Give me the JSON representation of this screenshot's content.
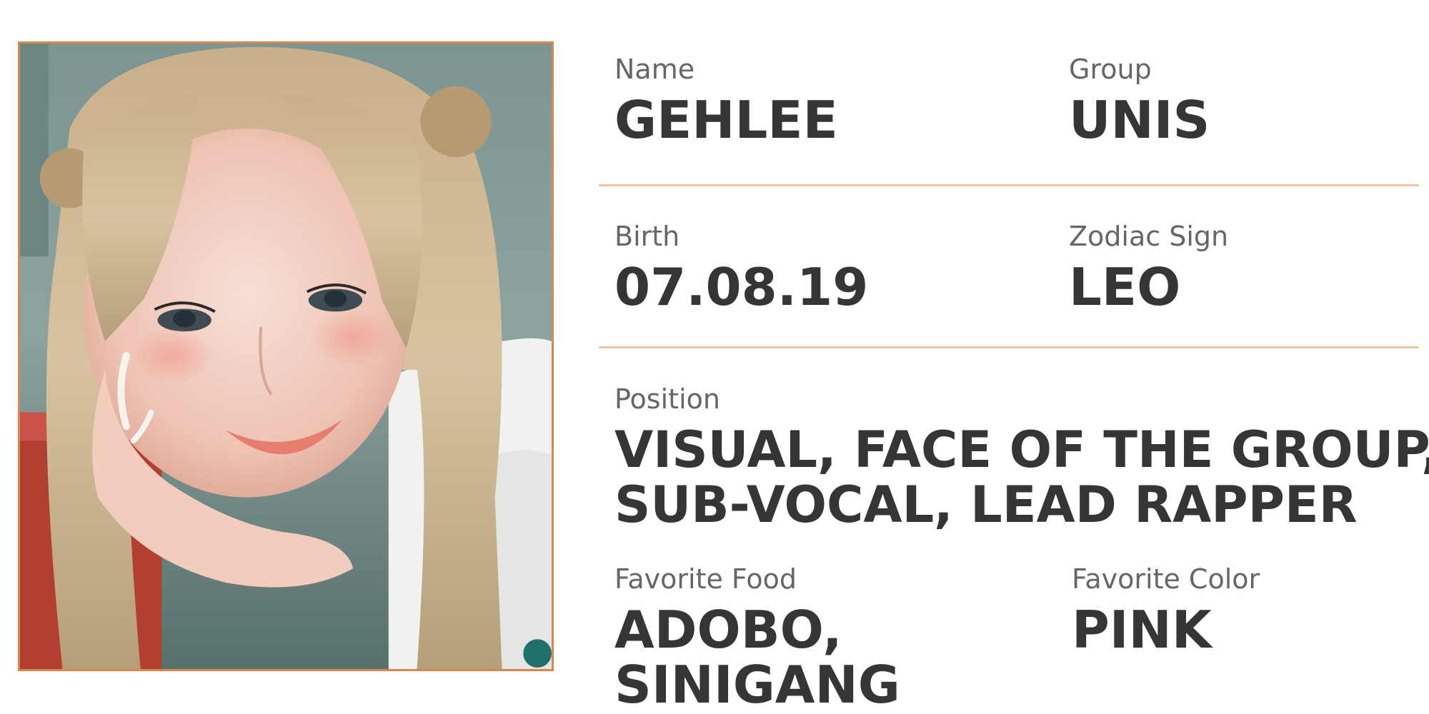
{
  "profile": {
    "name": {
      "label": "Name",
      "value": "GEHLEE"
    },
    "group": {
      "label": "Group",
      "value": "UNIS"
    },
    "birth": {
      "label": "Birth",
      "value": "07.08.19"
    },
    "zodiac": {
      "label": "Zodiac Sign",
      "value": "LEO"
    },
    "position": {
      "label": "Position",
      "line1": "VISUAL, FACE OF THE GROUP,",
      "line2": "SUB-VOCAL, LEAD RAPPER"
    },
    "favorite_food": {
      "label": "Favorite Food",
      "line1": "ADOBO,",
      "line2": "SINIGANG"
    },
    "favorite_color": {
      "label": "Favorite Color",
      "value": "PINK"
    }
  },
  "photo": {
    "subject": "portrait of a smiling person with long blonde hair resting chin on hand"
  },
  "colors": {
    "frame": "#d9874f",
    "divider": "#efc6a3",
    "label": "#666666",
    "value": "#353535"
  }
}
